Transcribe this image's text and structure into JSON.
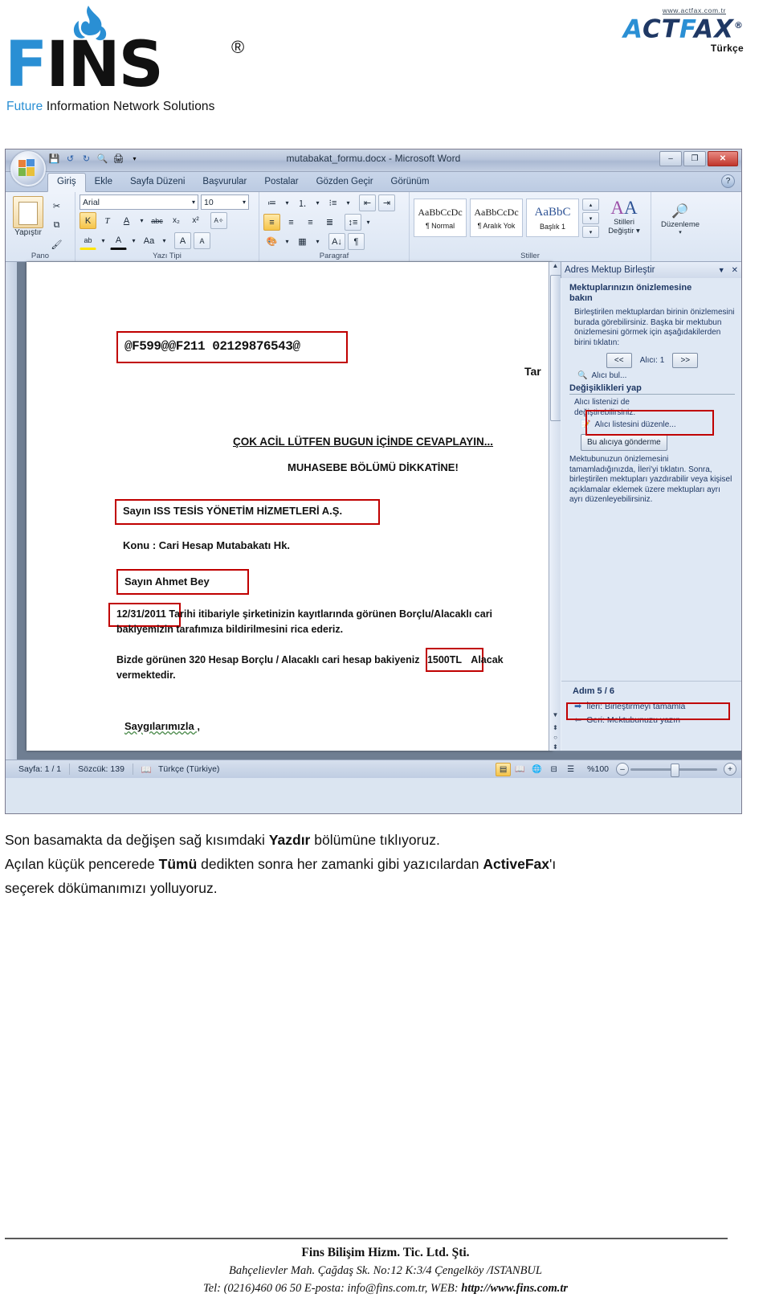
{
  "header": {
    "fins": {
      "wordmark": "FINS",
      "registered": "®",
      "tagline_1": "Future",
      "tagline_2": "Information Network Solutions"
    },
    "actfax": {
      "url": "www.actfax.com.tr",
      "name_part1": "A",
      "name_part2": "CT",
      "name_part3": "F",
      "name_part4": "AX",
      "registered": "®",
      "subtitle": "Türkçe"
    }
  },
  "word": {
    "titlebar": {
      "document_title": "mutabakat_formu.docx - Microsoft Word",
      "quick_access": [
        "save-icon",
        "undo-icon",
        "redo-icon",
        "print-preview-icon",
        "print-icon",
        "customize-icon"
      ],
      "minimize": "–",
      "maximize": "❐",
      "close": "✕"
    },
    "tabs": [
      "Giriş",
      "Ekle",
      "Sayfa Düzeni",
      "Başvurular",
      "Postalar",
      "Gözden Geçir",
      "Görünüm"
    ],
    "active_tab": "Giriş",
    "help_label": "?",
    "ribbon": {
      "groups": [
        {
          "name": "Pano",
          "big_button": "Yapıştır"
        },
        {
          "name": "Yazı Tipi"
        },
        {
          "name": "Paragraf"
        },
        {
          "name": "Stiller"
        },
        {
          "name": "Düzenleme"
        }
      ],
      "font_name": "Arial",
      "font_size": "10",
      "bold": "K",
      "italic": "T",
      "underline": "A",
      "strike": "abc",
      "subscript": "x₂",
      "superscript": "x²",
      "clear_format": "Aa!",
      "highlight": "ab",
      "fontcolor": "A",
      "changecase": "Aa",
      "grow": "A",
      "shrink": "A",
      "styles": [
        {
          "sample": "AaBbCcDc",
          "name": "¶ Normal"
        },
        {
          "sample": "AaBbCcDc",
          "name": "¶ Aralık Yok"
        },
        {
          "sample": "AaBbC",
          "name": "Başlık 1"
        }
      ],
      "change_styles": "Stilleri\nDeğiştir",
      "change_styles_l1": "Stilleri",
      "change_styles_l2": "Değiştir",
      "editing_label": "Düzenleme"
    },
    "document": {
      "fax_line": "@F599@@F211 02129876543@",
      "right_fragment": "Tar",
      "urgent_line": "ÇOK ACİL LÜTFEN BUGUN İÇİNDE CEVAPLAYIN...",
      "dept_line": "MUHASEBE BÖLÜMÜ DİKKATİNE!",
      "company_prefix": "Sayın",
      "company_name": "ISS TESİS YÖNETİM HİZMETLERİ A.Ş.",
      "subject_line": "Konu : Cari Hesap Mutabakatı Hk.",
      "greeting": "Sayın  Ahmet Bey",
      "date_field": "12/31/2011",
      "body_line_1": "Tarihi itibariyle şirketinizin kayıtlarında görünen Borçlu/Alacaklı cari",
      "body_line_2": "bakiyemizin tarafımıza bildirilmesini rica ederiz.",
      "body_line_3_pre": "Bizde görünen 320 Hesap Borçlu / Alacaklı cari hesap bakiyeniz",
      "amount_field": "1500TL",
      "body_line_3_post": "Alacak",
      "body_line_4": "vermektedir.",
      "closing": "Saygılarımızla ,"
    },
    "taskpane": {
      "title": "Adres Mektup Birleştir",
      "dropdown_icon": "chevron-down-icon",
      "close_icon": "✕",
      "heading_line1": "Mektuplarınızın önizlemesine",
      "heading_line2": "bakın",
      "paragraph_1": "Birleştirilen mektuplardan birinin önizlemesini burada görebilirsiniz. Başka bir mektubun önizlemesini görmek için aşağıdakilerden birini tıklatın:",
      "prev_button": "<<",
      "recipient_label": "Alıcı: 1",
      "next_button": ">>",
      "find_recipient": "Alıcı bul...",
      "changes_heading": "Değişiklikleri yap",
      "changes_paragraph_1": "Alıcı listenizi de",
      "changes_paragraph_2": "değiştirebilirsiniz:",
      "edit_list_link": "Alıcı listesini düzenle...",
      "exclude_button": "Bu alıcıya gönderme",
      "paragraph_2": "Mektubunuzun önizlemesini tamamladığınızda, İleri'yi tıklatın. Sonra, birleştirilen mektupları yazdırabilir veya kişisel açıklamalar eklemek üzere mektupları ayrı ayrı düzenleyebilirsiniz.",
      "step_label": "Adım 5 / 6",
      "next_step": "İleri: Birleştirmeyi tamamla",
      "prev_step": "Geri: Mektubunuzu yazın"
    },
    "statusbar": {
      "page": "Sayfa: 1 / 1",
      "words": "Sözcük: 139",
      "language": "Türkçe (Türkiye)",
      "proofing_icon": "spellcheck-icon",
      "zoom_level": "%100",
      "zoom_out": "–",
      "zoom_in": "+",
      "views": [
        "print-layout-icon",
        "full-screen-reading-icon",
        "web-layout-icon",
        "outline-icon",
        "draft-icon"
      ]
    }
  },
  "caption": {
    "line1_a": "Son basamakta da değişen sağ kısımdaki ",
    "line1_b": "Yazdır",
    "line1_c": " bölümüne tıklıyoruz.",
    "line2_a": " Açılan küçük pencerede ",
    "line2_b": "Tümü",
    "line2_c": " dedikten sonra her zamanki gibi yazıcılardan ",
    "line2_d": "ActiveFax",
    "line2_e": "'ı",
    "line3": "seçerek dökümanımızı yolluyoruz."
  },
  "footer": {
    "company": "Fins Bilişim Hizm. Tic. Ltd. Şti.",
    "address": "Bahçelievler Mah. Çağdaş Sk. No:12 K:3/4 Çengelköy /ISTANBUL",
    "contact_pre": "Tel: (0216)460 06 50  E-posta: info@fins.com.tr, WEB: ",
    "web": "http://www.fins.com.tr"
  },
  "colors": {
    "brand_blue": "#2a8fd4",
    "actfax_navy": "#1f3864",
    "highlight_red": "#c00000",
    "ribbon_bg": "#dbe5f3"
  }
}
